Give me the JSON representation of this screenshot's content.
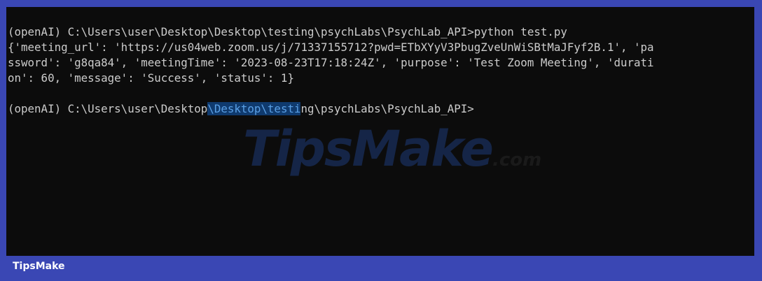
{
  "terminal": {
    "line1": "(openAI) C:\\Users\\user\\Desktop\\Desktop\\testing\\psychLabs\\PsychLab_API>python test.py",
    "line2": "{'meeting_url': 'https://us04web.zoom.us/j/71337155712?pwd=ETbXYyV3PbugZveUnWiSBtMaJFyf2B.1', 'pa",
    "line3": "ssword': 'g8qa84', 'meetingTime': '2023-08-23T17:18:24Z', 'purpose': 'Test Zoom Meeting', 'durati",
    "line4": "on': 60, 'message': 'Success', 'status': 1}",
    "prompt_before": "(openAI) C:\\Users\\user\\Desktop",
    "prompt_selected": "\\Desktop\\testi",
    "prompt_after": "ng\\psychLabs\\PsychLab_API>"
  },
  "watermark": {
    "main": "TipsMake",
    "suffix": ".com"
  },
  "footer": {
    "brand": "TipsMake"
  },
  "colors": {
    "frame": "#3a47b4",
    "terminal_bg": "#0c0c0c",
    "text": "#cccccc",
    "selection_bg": "#0f3a6e",
    "selection_text": "#5aa0e6"
  }
}
